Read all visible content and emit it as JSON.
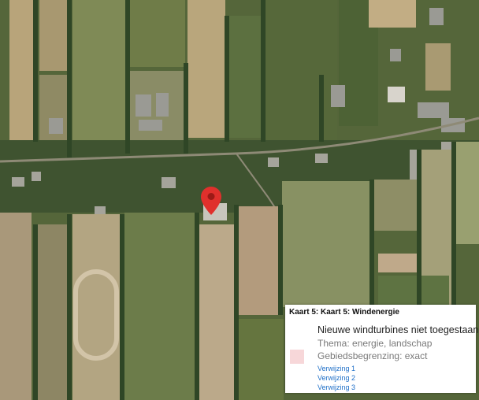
{
  "map": {
    "type": "aerial-imagery",
    "marker": {
      "color": "#e0302c"
    }
  },
  "popup": {
    "title": "Kaart 5: Kaart 5: Windenergie",
    "rule": {
      "title": "Nieuwe windturbines niet toegestaan",
      "theme": "Thema: energie, landschap",
      "boundary": "Gebiedsbegrenzing: exact",
      "color": "#f7d7d9"
    },
    "references": [
      "Verwijzing 1",
      "Verwijzing 2",
      "Verwijzing 3"
    ],
    "link_color": "#1e6fc8"
  }
}
